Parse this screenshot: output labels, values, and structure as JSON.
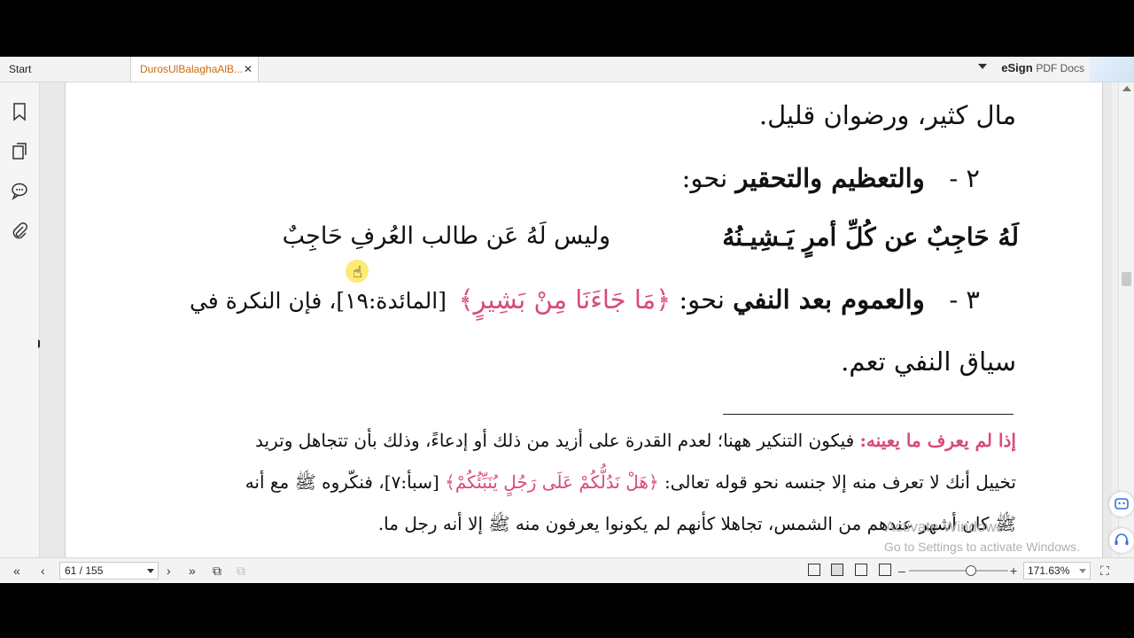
{
  "tabs": [
    {
      "label": "Start"
    },
    {
      "label": "DurosUlBalaghaAlB..."
    }
  ],
  "tab_close": "✕",
  "brand": {
    "bold": "eSign",
    "rest": "PDF Docs"
  },
  "sidebar_icons": [
    "bookmark-icon",
    "pages-icon",
    "comments-icon",
    "attachment-icon"
  ],
  "content": {
    "line1": "مال كثير، ورضوان قليل.",
    "line2_num": "٢ -",
    "line2_bold": "والتعظيم والتحقير",
    "line2_rest": "نحو:",
    "verse_a": "لَهُ حَاجِبٌ عن كُلِّ أمرٍ يَـشِيـنُهُ",
    "verse_b": "وليس لَهُ عَن طالب العُرفِ حَاجِبٌ",
    "line3_num": "٣ -",
    "line3_bold": "والعموم بعد النفي",
    "line3_mid": "نحو:",
    "line3_quote": "﴿مَا جَاءَنَا مِنْ بَشِيرٍ﴾",
    "line3_ref": "[المائدة:١٩]، فإن النكرة في",
    "line4": "سياق النفي تعم.",
    "note_heading": "إذا لم يعرف ما يعينه:",
    "note_line1_rest": "فيكون التنكير ههنا؛ لعدم القدرة على أزيد من ذلك أو إدعاءً، وذلك بأن تتجاهل وتريد",
    "note_line2_a": "تخييل أنك لا تعرف منه إلا جنسه نحو قوله تعالى:",
    "note_line2_quote": "﴿هَلْ نَدُلُّكُمْ عَلَى رَجُلٍ يُنَبِّئُكُمْ﴾",
    "note_line2_b": "[سبأ:٧]، فنكّروه ﷺ مع أنه",
    "note_line3": "ﷺ كان أشهر عندهم من الشمس، تجاهلا كأنهم لم يكونوا يعرفون منه ﷺ إلا أنه رجل ما."
  },
  "watermark": {
    "title": "Activate Windows",
    "subtitle": "Go to Settings to activate Windows."
  },
  "toolbar": {
    "page_indicator": "61 / 155",
    "zoom": "171.63%",
    "zoom_out": "–",
    "zoom_in": "+"
  }
}
